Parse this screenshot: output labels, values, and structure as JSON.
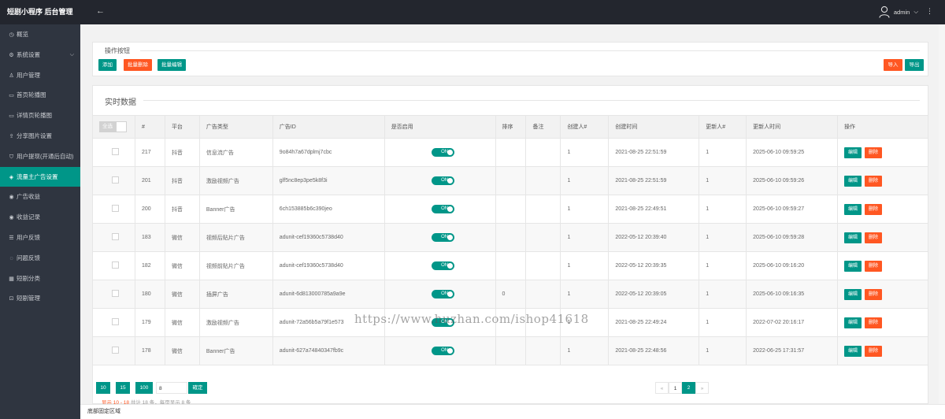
{
  "brand": "短剧小程序 后台管理",
  "sidebar": {
    "items": [
      {
        "label": "概览",
        "icon": "dashboard-icon",
        "glyph": "◷"
      },
      {
        "label": "系统设置",
        "icon": "gear-icon",
        "glyph": "⚙",
        "has_children": true
      },
      {
        "label": "用户管理",
        "icon": "user-icon",
        "glyph": "♙"
      },
      {
        "label": "首页轮播图",
        "icon": "image-icon",
        "glyph": "▭"
      },
      {
        "label": "详情页轮播图",
        "icon": "image-icon",
        "glyph": "▭"
      },
      {
        "label": "分享图片设置",
        "icon": "share-icon",
        "glyph": "⇪"
      },
      {
        "label": "用户提现(开通后自动)",
        "icon": "shield-icon",
        "glyph": "⛉"
      },
      {
        "label": "流量主广告设置",
        "icon": "diamond-icon",
        "glyph": "◈",
        "active": true
      },
      {
        "label": "广告收益",
        "icon": "coin-icon",
        "glyph": "◉"
      },
      {
        "label": "收益记录",
        "icon": "coin-icon",
        "glyph": "◉"
      },
      {
        "label": "用户反馈",
        "icon": "list-icon",
        "glyph": "☰"
      },
      {
        "label": "问题反馈",
        "icon": "help-icon",
        "glyph": "◌"
      },
      {
        "label": "短剧分类",
        "icon": "grid-icon",
        "glyph": "▦"
      },
      {
        "label": "短剧管理",
        "icon": "film-icon",
        "glyph": "⊡"
      }
    ]
  },
  "topbar": {
    "user": "admin",
    "back_icon": "arrow-left-icon",
    "more_icon": "more-vertical-icon"
  },
  "actions_panel": {
    "title": "操作按钮",
    "add": "添加",
    "bulk_delete": "批量删除",
    "bulk_edit": "批量编辑",
    "import": "导入",
    "export": "导出"
  },
  "data_panel": {
    "title": "实时数据"
  },
  "table": {
    "select_all": "全选",
    "headers": [
      "#",
      "平台",
      "广告类型",
      "广告ID",
      "是否启用",
      "排序",
      "备注",
      "创建人#",
      "创建时间",
      "更新人#",
      "更新人时间",
      "操作"
    ],
    "toggle_on": "ON",
    "edit": "编辑",
    "delete": "删除",
    "rows": [
      {
        "id": "217",
        "platform": "抖音",
        "type": "信息流广告",
        "ad_id": "9o84h7a67dplmj7cbc",
        "sort": "",
        "note": "",
        "creator": "1",
        "created": "2021-08-25 22:51:59",
        "updater": "1",
        "updated": "2025-06-10 09:59:25"
      },
      {
        "id": "201",
        "platform": "抖音",
        "type": "激励视频广告",
        "ad_id": "glf5nc8ep3pe5k8f3i",
        "sort": "",
        "note": "",
        "creator": "1",
        "created": "2021-08-25 22:51:59",
        "updater": "1",
        "updated": "2025-06-10 09:59:26"
      },
      {
        "id": "200",
        "platform": "抖音",
        "type": "Banner广告",
        "ad_id": "6ch153885b6c390jeo",
        "sort": "",
        "note": "",
        "creator": "1",
        "created": "2021-08-25 22:49:51",
        "updater": "1",
        "updated": "2025-06-10 09:59:27"
      },
      {
        "id": "183",
        "platform": "微信",
        "type": "视频后贴片广告",
        "ad_id": "adunit-cef19360c5738d40",
        "sort": "",
        "note": "",
        "creator": "1",
        "created": "2022-05-12 20:39:40",
        "updater": "1",
        "updated": "2025-06-10 09:59:28"
      },
      {
        "id": "182",
        "platform": "微信",
        "type": "视频前贴片广告",
        "ad_id": "adunit-cef19360c5738d40",
        "sort": "",
        "note": "",
        "creator": "1",
        "created": "2022-05-12 20:39:35",
        "updater": "1",
        "updated": "2025-06-10 09:16:20"
      },
      {
        "id": "180",
        "platform": "微信",
        "type": "插屏广告",
        "ad_id": "adunit-6d813000785a9a9e",
        "sort": "0",
        "note": "",
        "creator": "1",
        "created": "2022-05-12 20:39:05",
        "updater": "1",
        "updated": "2025-06-10 09:16:35"
      },
      {
        "id": "179",
        "platform": "微信",
        "type": "激励视频广告",
        "ad_id": "adunit-72a56b5a79f1e573",
        "sort": "",
        "note": "",
        "creator": "1",
        "created": "2021-08-25 22:49:24",
        "updater": "1",
        "updated": "2022-07-02 20:16:17"
      },
      {
        "id": "178",
        "platform": "微信",
        "type": "Banner广告",
        "ad_id": "adunit-627a74840347fb9c",
        "sort": "",
        "note": "",
        "creator": "1",
        "created": "2021-08-25 22:48:56",
        "updater": "1",
        "updated": "2022-06-25 17:31:57"
      }
    ]
  },
  "pagination": {
    "size_10": "10",
    "size_15": "15",
    "size_100": "100",
    "page_input": "8",
    "confirm": "確定",
    "prev": "«",
    "page_1": "1",
    "page_2": "2",
    "next": "»",
    "summary_highlight": "显示 10 - 18",
    "summary_rest": " 共计 18 条，每页显示 8 条"
  },
  "footer": "底部固定区域",
  "watermark": "https://www.huzhan.com/ishop41618",
  "colors": {
    "accent": "#009688",
    "danger": "#ff5722",
    "sidebar": "#2f3540",
    "topbar": "#23262e"
  }
}
